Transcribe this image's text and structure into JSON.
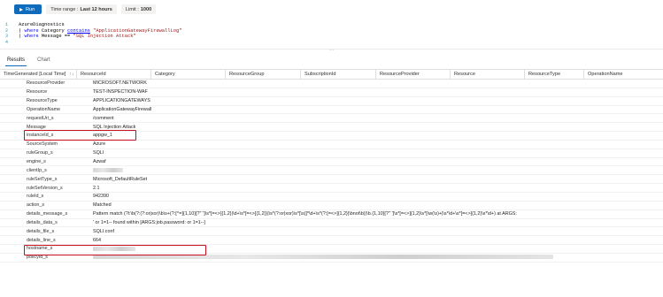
{
  "toolbar": {
    "run_label": "Run",
    "time_range_label": "Time range :",
    "time_range_value": "Last 12 hours",
    "limit_label": "Limit :",
    "limit_value": "1000"
  },
  "editor": {
    "lines": [
      {
        "num": "1",
        "text": "AzureDiagnostics"
      },
      {
        "num": "2",
        "pipe": "| ",
        "kw": "where",
        "field": " Category ",
        "op": "contains",
        "str": " \"ApplicationGatewayFirewallLog\""
      },
      {
        "num": "3",
        "pipe": "| ",
        "kw": "where",
        "field": " Message == ",
        "str": "\"SQL Injection Attack\""
      },
      {
        "num": "4",
        "text": ""
      }
    ]
  },
  "tabs": [
    "Results",
    "Chart"
  ],
  "columns": [
    "TimeGenerated [Local Time]",
    "ResourceId",
    "Category",
    "ResourceGroup",
    "SubscriptionId",
    "ResourceProvider",
    "Resource",
    "ResourceType",
    "OperationName"
  ],
  "details": [
    {
      "key": "ResourceProvider",
      "value": "MICROSOFT.NETWORK"
    },
    {
      "key": "Resource",
      "value": "TEST-INSPECTION-WAF"
    },
    {
      "key": "ResourceType",
      "value": "APPLICATIONGATEWAYS"
    },
    {
      "key": "OperationName",
      "value": "ApplicationGatewayFirewall"
    },
    {
      "key": "requestUri_s",
      "value": "/comment"
    },
    {
      "key": "Message",
      "value": "SQL Injection Attack"
    },
    {
      "key": "instanceId_s",
      "value": "appgw_1"
    },
    {
      "key": "SourceSystem",
      "value": "Azure"
    },
    {
      "key": "ruleGroup_s",
      "value": "SQLI"
    },
    {
      "key": "engine_s",
      "value": "Azwaf"
    },
    {
      "key": "clientIp_s",
      "value": ""
    },
    {
      "key": "ruleSetType_s",
      "value": "Microsoft_DefaultRuleSet"
    },
    {
      "key": "ruleSetVersion_s",
      "value": "2.1"
    },
    {
      "key": "ruleId_s",
      "value": "942390"
    },
    {
      "key": "action_s",
      "value": "Matched"
    },
    {
      "key": "details_message_s",
      "value": "Pattern match (?i:\\b(?:(?:or|xor)\\b\\s+(?:[^=]{1,10}[?\"`']\\s*[=<>]{1,2}|\\d+\\s*[=<>]{1,2})|\\s*(?:or|xor)\\s*[\\s(]*\\d+\\s*(?:[=<>]{1,2}|\\bnot\\b))\\b.{1,10}[?\"`']\\s*[=<>]{1,2}\\s*[\\w(\\s)+|\\s*\\d+\\s*[=<>]{1,2}\\s*\\d+) at ARGS:"
    },
    {
      "key": "details_data_s",
      "value": "' or 1=1-- found within [ARGS:job.password: or 1=1--]"
    },
    {
      "key": "details_file_s",
      "value": "SQLI.conf"
    },
    {
      "key": "details_line_s",
      "value": "664"
    },
    {
      "key": "hostname_s",
      "value": ""
    },
    {
      "key": "policyId_s",
      "value": ""
    }
  ]
}
